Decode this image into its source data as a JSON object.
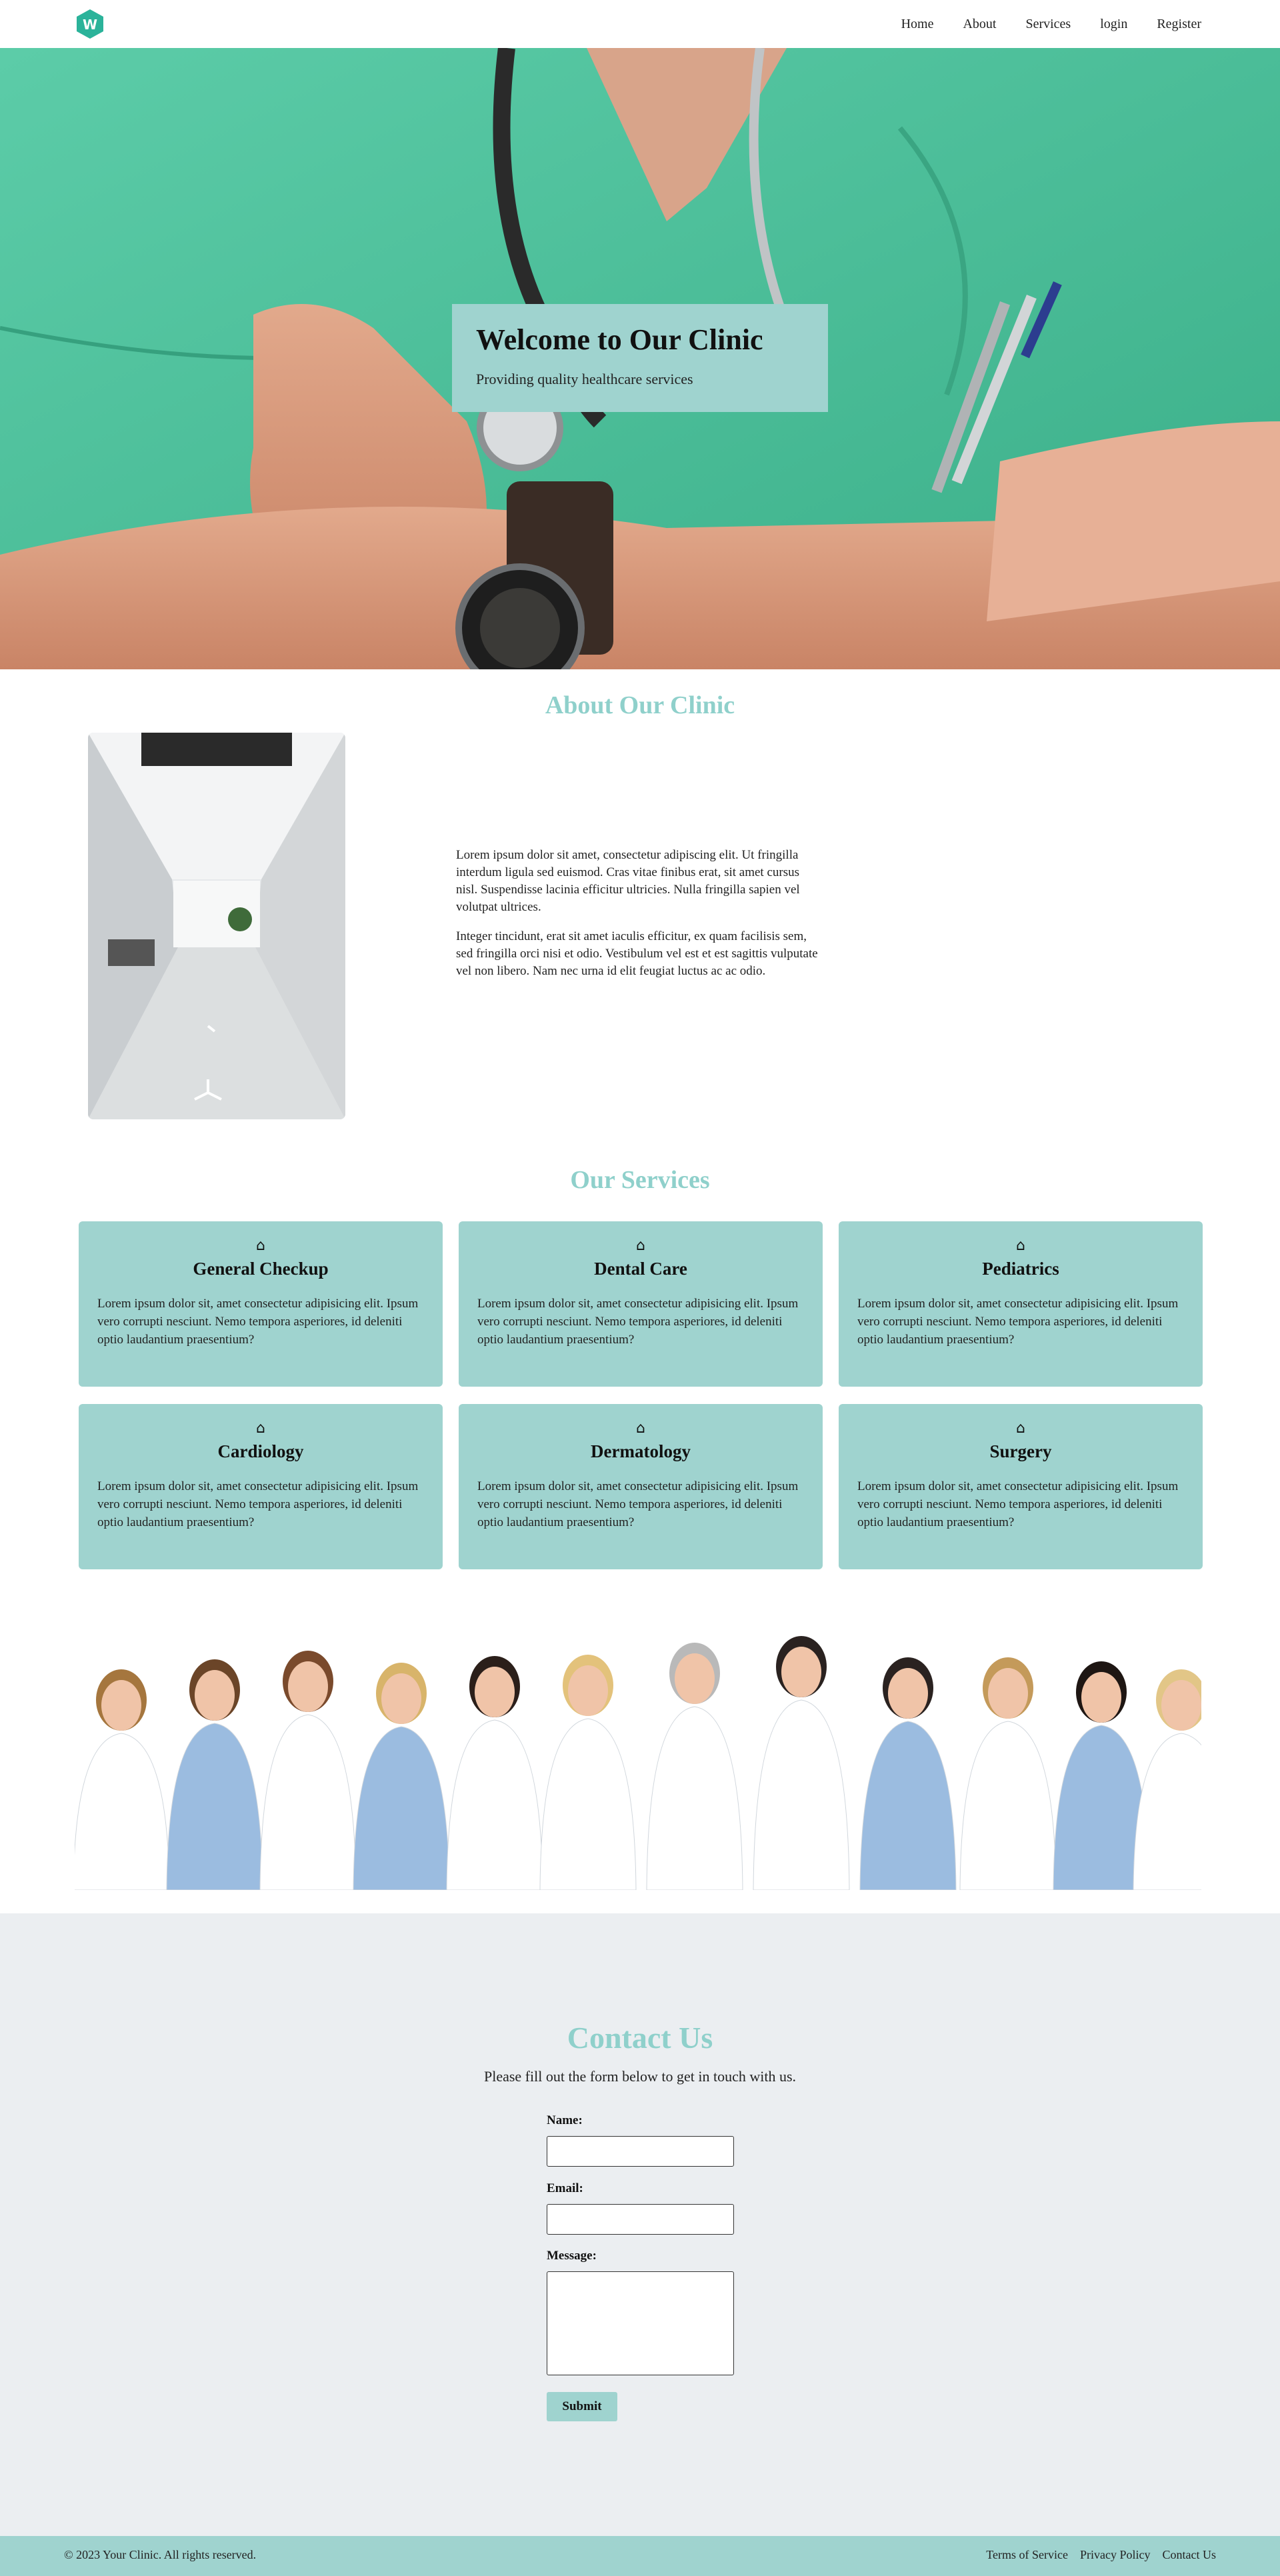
{
  "nav": {
    "logo_letter": "W",
    "links": [
      "Home",
      "About",
      "Services",
      "login",
      "Register"
    ]
  },
  "hero": {
    "title": "Welcome to Our Clinic",
    "subtitle": "Providing quality healthcare services"
  },
  "about": {
    "title": "About Our Clinic",
    "paragraphs": [
      "Lorem ipsum dolor sit amet, consectetur adipiscing elit. Ut fringilla interdum ligula sed euismod. Cras vitae finibus erat, sit amet cursus nisl. Suspendisse lacinia efficitur ultricies. Nulla fringilla sapien vel volutpat ultrices.",
      "Integer tincidunt, erat sit amet iaculis efficitur, ex quam facilisis sem, sed fringilla orci nisi et odio. Vestibulum vel est et est sagittis vulputate vel non libero. Nam nec urna id elit feugiat luctus ac ac odio."
    ]
  },
  "services": {
    "title": "Our Services",
    "icon": "⌂",
    "items": [
      {
        "title": "General Checkup",
        "desc": "Lorem ipsum dolor sit, amet consectetur adipisicing elit. Ipsum vero corrupti nesciunt. Nemo tempora asperiores, id deleniti optio laudantium praesentium?"
      },
      {
        "title": "Dental Care",
        "desc": "Lorem ipsum dolor sit, amet consectetur adipisicing elit. Ipsum vero corrupti nesciunt. Nemo tempora asperiores, id deleniti optio laudantium praesentium?"
      },
      {
        "title": "Pediatrics",
        "desc": "Lorem ipsum dolor sit, amet consectetur adipisicing elit. Ipsum vero corrupti nesciunt. Nemo tempora asperiores, id deleniti optio laudantium praesentium?"
      },
      {
        "title": "Cardiology",
        "desc": "Lorem ipsum dolor sit, amet consectetur adipisicing elit. Ipsum vero corrupti nesciunt. Nemo tempora asperiores, id deleniti optio laudantium praesentium?"
      },
      {
        "title": "Dermatology",
        "desc": "Lorem ipsum dolor sit, amet consectetur adipisicing elit. Ipsum vero corrupti nesciunt. Nemo tempora asperiores, id deleniti optio laudantium praesentium?"
      },
      {
        "title": "Surgery",
        "desc": "Lorem ipsum dolor sit, amet consectetur adipisicing elit. Ipsum vero corrupti nesciunt. Nemo tempora asperiores, id deleniti optio laudantium praesentium?"
      }
    ]
  },
  "contact": {
    "title": "Contact Us",
    "subtitle": "Please fill out the form below to get in touch with us.",
    "name_label": "Name:",
    "email_label": "Email:",
    "message_label": "Message:",
    "submit_label": "Submit"
  },
  "footer": {
    "copyright": "© 2023 Your Clinic. All rights reserved.",
    "links": [
      "Terms of Service",
      "Privacy Policy",
      "Contact Us"
    ]
  },
  "colors": {
    "accent": "#9fd3cf",
    "heading_accent": "#8fd0cb",
    "logo": "#2bb39a",
    "scrubs": "#4fc59e",
    "contact_bg": "#ebeef1"
  }
}
